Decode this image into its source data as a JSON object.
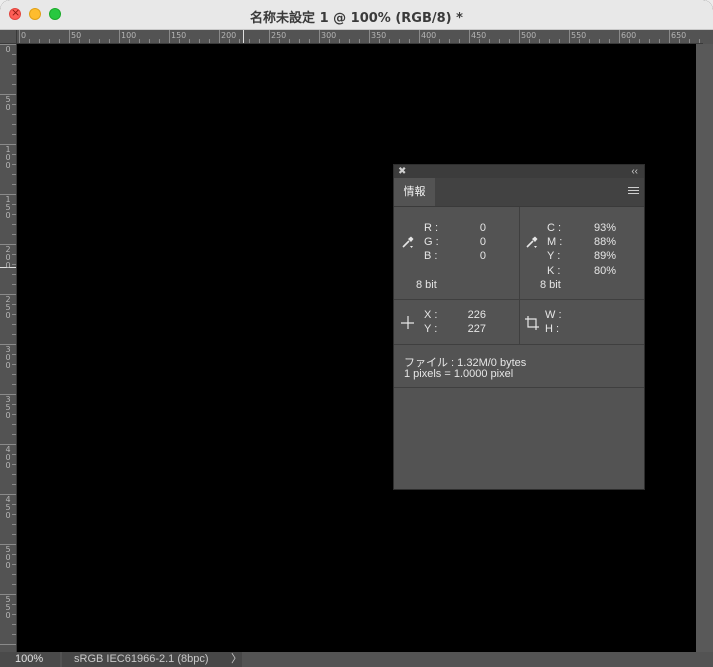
{
  "window": {
    "title": "名称未設定 1 @ 100% (RGB/8) *"
  },
  "ruler": {
    "top_labels": [
      "0",
      "50",
      "100",
      "150",
      "200",
      "250",
      "300",
      "350",
      "400",
      "450",
      "500",
      "550",
      "600",
      "650"
    ],
    "left_labels": [
      "0",
      "50",
      "100",
      "150",
      "200",
      "250",
      "300",
      "350",
      "400",
      "450",
      "500",
      "550"
    ]
  },
  "info_panel": {
    "tab_label": "情報",
    "rgb": {
      "labels": [
        "R :",
        "G :",
        "B :"
      ],
      "values": [
        "0",
        "0",
        "0"
      ],
      "bit": "8 bit"
    },
    "cmyk": {
      "labels": [
        "C :",
        "M :",
        "Y :",
        "K :"
      ],
      "values": [
        "93%",
        "88%",
        "89%",
        "80%"
      ],
      "bit": "8 bit"
    },
    "position": {
      "labels": [
        "X :",
        "Y :"
      ],
      "values": [
        "226",
        "227"
      ]
    },
    "size": {
      "labels": [
        "W :",
        "H :"
      ]
    },
    "file_info": "ファイル : 1.32M/0 bytes",
    "pixel_info": "1 pixels = 1.0000 pixel"
  },
  "statusbar": {
    "zoom": "100%",
    "profile": "sRGB IEC61966-2.1 (8bpc)",
    "arrow": "〉"
  }
}
